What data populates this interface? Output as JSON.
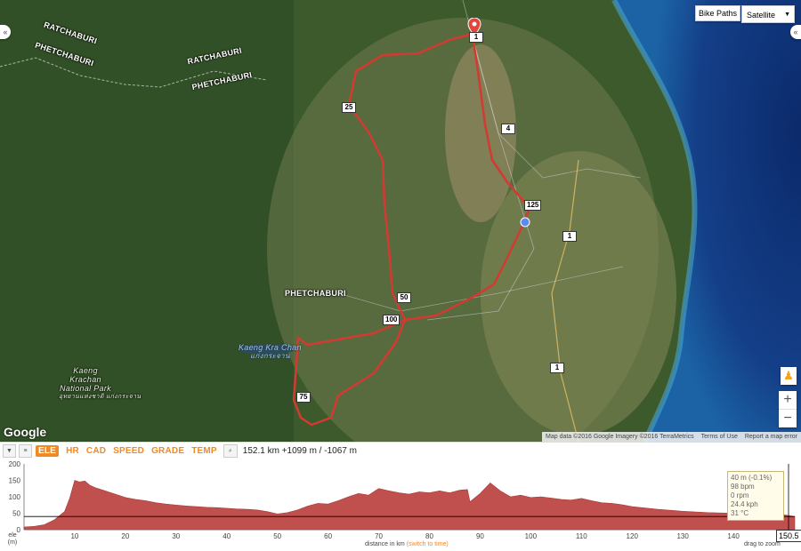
{
  "map": {
    "type_select": "Satellite",
    "bike_paths_label": "Bike Paths",
    "region_labels": [
      "RATCHABURI",
      "PHETCHABURI",
      "RATCHABURI",
      "PHETCHABURI",
      "PHETCHABURI"
    ],
    "lake_label": "Kaeng Kra Chan",
    "lake_label_thai": "แก่งกระจาน",
    "park_label_lines": [
      "Kaeng",
      "Krachan",
      "National Park"
    ],
    "park_label_thai": "อุทยานแห่งชาติ แก่งกระจาน",
    "road_shields": [
      "25",
      "4",
      "125",
      "1",
      "1",
      "50",
      "100",
      "75"
    ],
    "start_marker_number": "1",
    "google_logo": "Google",
    "attribution": "Map data ©2016 Google Imagery ©2016 TerraMetrics",
    "terms": "Terms of Use",
    "report": "Report a map error",
    "zoom_in": "+",
    "zoom_out": "−"
  },
  "toolbar": {
    "tabs": [
      "ELE",
      "HR",
      "CAD",
      "SPEED",
      "GRADE",
      "TEMP"
    ],
    "active_tab": "ELE",
    "summary": "152.1 km +1099 m / -1067 m"
  },
  "profile": {
    "y_label_top": "ele",
    "y_label_bottom": "(m)",
    "x_label": "distance in km",
    "x_label_link": "(switch to time)",
    "drag_hint": "drag to zoom",
    "cursor_value": "150.5",
    "tooltip_lines": [
      "40 m (-0.1%)",
      "98 bpm",
      "0 rpm",
      "24.4 kph",
      "31 °C"
    ]
  },
  "chart_data": {
    "type": "area",
    "title": "",
    "xlabel": "distance in km",
    "ylabel": "ele (m)",
    "xlim": [
      0,
      152.1
    ],
    "ylim": [
      0,
      200
    ],
    "x_ticks": [
      10,
      20,
      30,
      40,
      50,
      60,
      70,
      80,
      90,
      100,
      110,
      120,
      130,
      140
    ],
    "y_ticks": [
      0,
      50,
      100,
      150,
      200
    ],
    "color": "#c0504d",
    "series": [
      {
        "x": [
          0,
          2,
          4,
          6,
          8,
          9,
          10,
          11,
          12,
          13,
          14,
          16,
          18,
          20,
          22,
          24,
          26,
          28,
          30,
          32,
          34,
          36,
          38,
          40,
          42,
          44,
          46,
          48,
          50,
          52,
          54,
          56,
          58,
          60,
          62,
          64,
          66,
          68,
          70,
          72,
          74,
          76,
          78,
          80,
          82,
          84,
          86,
          87.5,
          88,
          90,
          92,
          94,
          96,
          98,
          100,
          102,
          104,
          106,
          108,
          110,
          112,
          114,
          116,
          118,
          120,
          125,
          130,
          135,
          140,
          145,
          150,
          152.1
        ],
        "y": [
          8,
          10,
          15,
          30,
          55,
          95,
          150,
          145,
          148,
          135,
          128,
          118,
          108,
          98,
          92,
          88,
          82,
          78,
          75,
          72,
          70,
          68,
          67,
          65,
          63,
          62,
          60,
          55,
          48,
          52,
          60,
          72,
          80,
          78,
          88,
          100,
          110,
          105,
          125,
          118,
          112,
          108,
          115,
          112,
          118,
          112,
          120,
          122,
          85,
          110,
          142,
          118,
          100,
          105,
          98,
          100,
          96,
          92,
          90,
          95,
          88,
          82,
          80,
          76,
          70,
          62,
          56,
          52,
          50,
          48,
          45,
          40
        ]
      }
    ],
    "cursor_line_y": 40,
    "grid": false
  }
}
